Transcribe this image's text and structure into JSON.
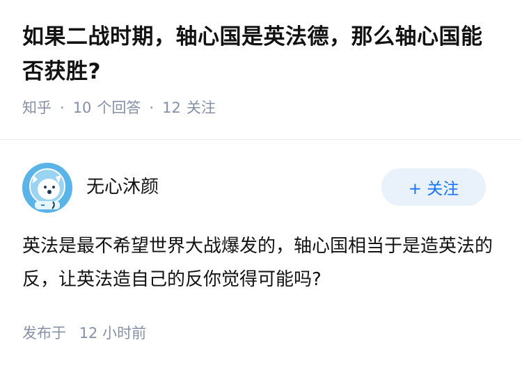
{
  "question": {
    "title": "如果二战时期，轴心国是英法德，那么轴心国能否获胜?",
    "source": "知乎",
    "answer_count": "10",
    "answer_label": "个回答",
    "follow_count": "12",
    "follow_label": "关注"
  },
  "answer": {
    "author_name": "无心沐颜",
    "follow_button_label": "+ 关注",
    "content": "英法是最不希望世界大战爆发的，轴心国相当于是造英法的反，让英法造自己的反你觉得可能吗?",
    "published_label": "发布于",
    "published_time": "12 小时前"
  },
  "colors": {
    "title": "#121212",
    "meta": "#8590a6",
    "accent": "#1772f6",
    "follow_bg": "#e9f1fb",
    "avatar_bg": "#5ab4e8"
  },
  "icons": {
    "avatar": "cartoon-dog-astronaut-avatar"
  }
}
